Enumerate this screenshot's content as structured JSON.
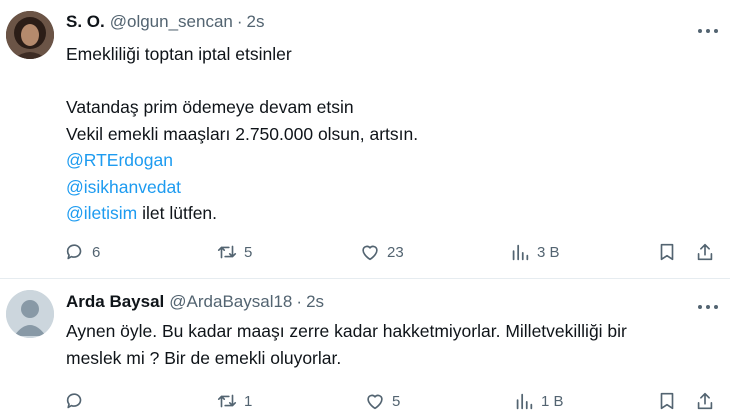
{
  "tweets": [
    {
      "name": "S. O.",
      "handle": "@olgun_sencan",
      "time": "2s",
      "lines": [
        "Emekliliği toptan iptal etsinler",
        "",
        "Vatandaş prim ödemeye devam etsin",
        "Vekil emekli maaşları 2.750.000 olsun, artsın."
      ],
      "mentions": [
        "@RTErdogan",
        "@isikhanvedat",
        "@iletisim"
      ],
      "mention_suffix": " ilet lütfen.",
      "actions": {
        "replies": "6",
        "reposts": "5",
        "likes": "23",
        "views": "3 B"
      }
    },
    {
      "name": "Arda Baysal",
      "handle": "@ArdaBaysal18",
      "time": "2s",
      "lines": [
        "Aynen öyle. Bu kadar maaşı zerre kadar hakketmiyorlar. Milletvekilliği bir",
        "meslek mi ? Bir de emekli oluyorlar."
      ],
      "actions": {
        "replies": "",
        "reposts": "1",
        "likes": "5",
        "views": "1 B"
      }
    }
  ],
  "separator": "·",
  "colors": {
    "text": "#0f1419",
    "secondary": "#536471",
    "link": "#1d9bf0",
    "divider": "#e6ecf0"
  },
  "icons": [
    "reply-icon",
    "repost-icon",
    "like-icon",
    "views-icon",
    "bookmark-icon",
    "share-icon",
    "more-icon"
  ]
}
